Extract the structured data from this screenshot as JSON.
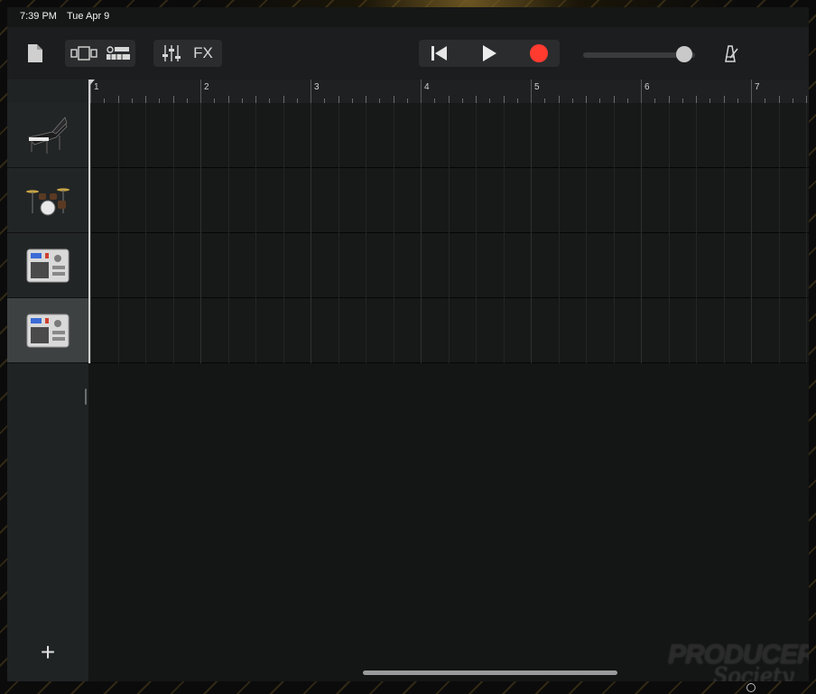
{
  "status_bar": {
    "time": "7:39 PM",
    "date": "Tue Apr 9"
  },
  "toolbar": {
    "document_icon": "document-icon",
    "view_toggle_icon": "track-view-icon",
    "editor_icon": "editor-icon",
    "mixer_icon": "mixer-sliders-icon",
    "fx_label": "FX",
    "rewind_icon": "go-to-beginning-icon",
    "play_icon": "play-icon",
    "record_icon": "record-icon",
    "metronome_icon": "metronome-icon",
    "record_color": "#ff3b30",
    "volume_level": 0.9
  },
  "ruler": {
    "bars": [
      "1",
      "2",
      "3",
      "4",
      "5",
      "6",
      "7"
    ]
  },
  "tracks": [
    {
      "name": "grand-piano",
      "icon": "grand-piano-icon",
      "selected": false
    },
    {
      "name": "drum-kit",
      "icon": "drum-kit-icon",
      "selected": false
    },
    {
      "name": "beat-sequencer",
      "icon": "drum-machine-icon",
      "selected": false
    },
    {
      "name": "beat-sequencer-2",
      "icon": "drum-machine-icon",
      "selected": true
    }
  ],
  "add_track_label": "+",
  "watermark": {
    "line1": "PRODUCER",
    "line2": "Society"
  }
}
